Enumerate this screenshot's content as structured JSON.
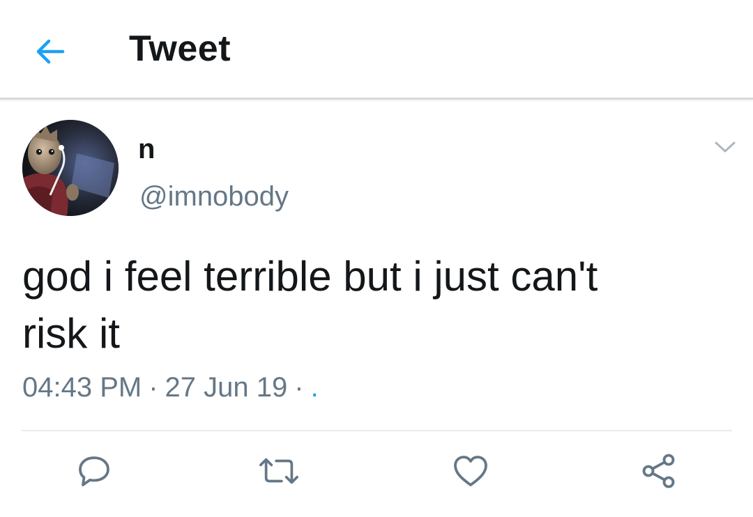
{
  "header": {
    "title": "Tweet",
    "back_icon": "arrow-left-icon"
  },
  "tweet": {
    "display_name": "n",
    "handle": "@imnobody",
    "text_line1": "god i feel terrible but i just can't",
    "text_line2": "risk it",
    "time": "04:43 PM",
    "date": "27 Jun 19",
    "source": ".",
    "separator": "·"
  },
  "actions": [
    {
      "name": "reply",
      "icon": "reply-icon"
    },
    {
      "name": "retweet",
      "icon": "retweet-icon"
    },
    {
      "name": "like",
      "icon": "heart-icon"
    },
    {
      "name": "share",
      "icon": "share-icon"
    }
  ],
  "colors": {
    "accent": "#1da1f2",
    "text": "#14171a",
    "secondary_text": "#657786",
    "icon_gray": "#657786"
  }
}
